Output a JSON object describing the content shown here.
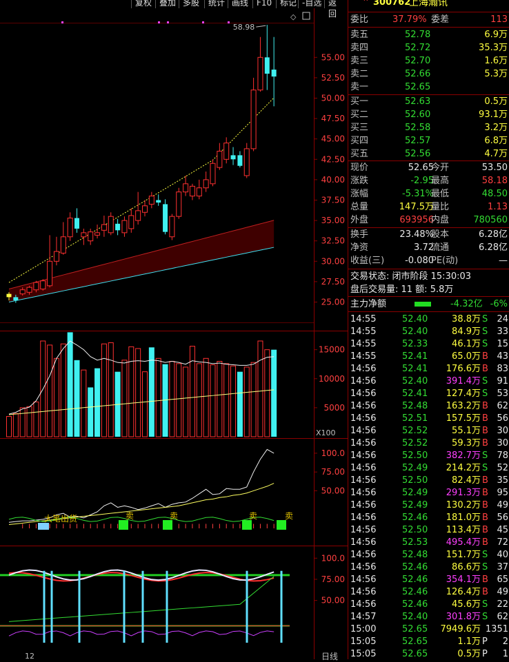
{
  "toolbar": {
    "items": [
      "复权",
      "叠加",
      "多股",
      "统计",
      "画线",
      "F10",
      "标记",
      "-自选",
      "返回"
    ]
  },
  "stock": {
    "code": "300762",
    "name": "上海瀚讯",
    "badge": "R"
  },
  "chart_data": [
    {
      "type": "candlestick",
      "title": "",
      "y_ticks": [
        55.0,
        52.5,
        50.0,
        47.5,
        45.0,
        42.5,
        40.0,
        37.5,
        35.0,
        32.5,
        30.0,
        27.5,
        25.0
      ],
      "ylim": [
        22.0,
        59.5
      ],
      "high_annotation": "58.98",
      "candles": [
        {
          "o": 25.6,
          "h": 26.2,
          "l": 25.2,
          "c": 26.0
        },
        {
          "o": 25.6,
          "h": 25.9,
          "l": 24.9,
          "c": 25.2
        },
        {
          "o": 26.0,
          "h": 26.8,
          "l": 25.8,
          "c": 26.5
        },
        {
          "o": 26.2,
          "h": 27.0,
          "l": 25.9,
          "c": 26.8
        },
        {
          "o": 26.5,
          "h": 27.6,
          "l": 26.2,
          "c": 27.4
        },
        {
          "o": 26.6,
          "h": 27.8,
          "l": 26.4,
          "c": 27.6
        },
        {
          "o": 27.0,
          "h": 33.2,
          "l": 26.8,
          "c": 30.0
        },
        {
          "o": 30.0,
          "h": 33.0,
          "l": 29.5,
          "c": 31.2
        },
        {
          "o": 31.0,
          "h": 34.8,
          "l": 30.8,
          "c": 33.0
        },
        {
          "o": 33.0,
          "h": 36.0,
          "l": 32.5,
          "c": 35.3
        },
        {
          "o": 35.3,
          "h": 36.5,
          "l": 33.5,
          "c": 34.0
        },
        {
          "o": 33.0,
          "h": 34.0,
          "l": 32.0,
          "c": 33.5
        },
        {
          "o": 32.5,
          "h": 34.0,
          "l": 32.0,
          "c": 33.6
        },
        {
          "o": 33.2,
          "h": 34.5,
          "l": 32.8,
          "c": 33.5
        },
        {
          "o": 33.8,
          "h": 35.6,
          "l": 33.0,
          "c": 34.5
        },
        {
          "o": 33.5,
          "h": 36.0,
          "l": 33.2,
          "c": 35.5
        },
        {
          "o": 34.6,
          "h": 35.2,
          "l": 33.2,
          "c": 33.8
        },
        {
          "o": 33.5,
          "h": 35.5,
          "l": 33.0,
          "c": 35.0
        },
        {
          "o": 34.0,
          "h": 36.5,
          "l": 33.5,
          "c": 35.6
        },
        {
          "o": 35.0,
          "h": 38.5,
          "l": 34.5,
          "c": 36.2
        },
        {
          "o": 36.0,
          "h": 37.5,
          "l": 35.5,
          "c": 36.8
        },
        {
          "o": 37.0,
          "h": 38.5,
          "l": 36.5,
          "c": 38.0
        },
        {
          "o": 37.5,
          "h": 38.2,
          "l": 36.8,
          "c": 37.2
        },
        {
          "o": 37.0,
          "h": 37.6,
          "l": 33.3,
          "c": 33.6
        },
        {
          "o": 33.0,
          "h": 35.8,
          "l": 32.6,
          "c": 35.5
        },
        {
          "o": 35.5,
          "h": 39.0,
          "l": 35.2,
          "c": 38.5
        },
        {
          "o": 38.5,
          "h": 40.5,
          "l": 38.0,
          "c": 39.5
        },
        {
          "o": 38.0,
          "h": 39.5,
          "l": 37.5,
          "c": 39.2
        },
        {
          "o": 38.0,
          "h": 40.0,
          "l": 37.6,
          "c": 39.0
        },
        {
          "o": 39.0,
          "h": 41.0,
          "l": 38.5,
          "c": 40.0
        },
        {
          "o": 39.5,
          "h": 42.5,
          "l": 39.2,
          "c": 42.0
        },
        {
          "o": 41.5,
          "h": 44.5,
          "l": 41.2,
          "c": 43.5
        },
        {
          "o": 42.5,
          "h": 45.2,
          "l": 42.0,
          "c": 44.5
        },
        {
          "o": 43.0,
          "h": 44.0,
          "l": 41.8,
          "c": 42.5
        },
        {
          "o": 43.0,
          "h": 43.5,
          "l": 41.5,
          "c": 41.7
        },
        {
          "o": 40.5,
          "h": 44.5,
          "l": 40.2,
          "c": 43.8
        },
        {
          "o": 43.8,
          "h": 52.5,
          "l": 43.5,
          "c": 51.0
        },
        {
          "o": 51.0,
          "h": 57.5,
          "l": 50.8,
          "c": 55.0
        },
        {
          "o": 55.0,
          "h": 58.98,
          "l": 51.0,
          "c": 53.0
        },
        {
          "o": 53.5,
          "h": 57.5,
          "l": 49.0,
          "c": 52.65
        }
      ]
    },
    {
      "type": "bar",
      "title": "",
      "y_ticks": [
        15000,
        10000,
        5000
      ],
      "ylim": [
        0,
        16500
      ],
      "unit_label": "X100",
      "values": [
        3500,
        4000,
        5000,
        5200,
        6000,
        16500,
        15800,
        13500,
        16000,
        18000,
        13200,
        11500,
        8500,
        11800,
        16000,
        16200,
        11200,
        13200,
        15500,
        15200,
        11200,
        15400,
        13500,
        12500,
        13000,
        12600,
        12000,
        15600,
        12600,
        13500,
        12400,
        13000,
        12600,
        12200,
        11200,
        12000,
        12800,
        16500,
        15000,
        15000
      ],
      "down_flags": [
        0,
        0,
        0,
        0,
        0,
        0,
        0,
        0,
        0,
        1,
        1,
        0,
        1,
        1,
        0,
        0,
        1,
        0,
        0,
        0,
        0,
        1,
        0,
        1,
        0,
        0,
        0,
        0,
        0,
        0,
        0,
        0,
        0,
        0,
        1,
        0,
        0,
        0,
        0,
        1
      ]
    },
    {
      "type": "line",
      "title": "",
      "y_ticks": [
        100.0,
        75.0,
        50.0
      ],
      "ylim": [
        0,
        110
      ],
      "annotations": [
        "大笔出货",
        "卖",
        "卖",
        "卖",
        "卖"
      ]
    },
    {
      "type": "line",
      "title": "",
      "y_ticks": [
        100.0,
        75.0,
        50.0
      ],
      "ylim": [
        0,
        110
      ]
    }
  ],
  "date_tick": "12",
  "corner_label": "日线",
  "quote": {
    "weibi": {
      "label": "委比",
      "value": "37.79%",
      "label2": "委差",
      "value2": "113"
    },
    "asks": [
      {
        "label": "卖五",
        "price": "52.78",
        "vol": "6.9万"
      },
      {
        "label": "卖四",
        "price": "52.72",
        "vol": "35.3万"
      },
      {
        "label": "卖三",
        "price": "52.70",
        "vol": "1.6万"
      },
      {
        "label": "卖二",
        "price": "52.66",
        "vol": "5.3万"
      },
      {
        "label": "卖一",
        "price": "52.65",
        "vol": ""
      }
    ],
    "bids": [
      {
        "label": "买一",
        "price": "52.63",
        "vol": "0.5万"
      },
      {
        "label": "买二",
        "price": "52.60",
        "vol": "93.1万"
      },
      {
        "label": "买三",
        "price": "52.58",
        "vol": "3.2万"
      },
      {
        "label": "买四",
        "price": "52.57",
        "vol": "6.8万"
      },
      {
        "label": "买五",
        "price": "52.56",
        "vol": "4.7万"
      }
    ],
    "stats": [
      {
        "l1": "现价",
        "v1": "52.65",
        "l2": "今开",
        "v2": "53.50"
      },
      {
        "l1": "涨跌",
        "v1": "-2.95",
        "l2": "最高",
        "v2": "58.18"
      },
      {
        "l1": "涨幅",
        "v1": "-5.31%",
        "l2": "最低",
        "v2": "48.50"
      },
      {
        "l1": "总量",
        "v1": "147.5万",
        "l2": "量比",
        "v2": "1.13"
      },
      {
        "l1": "外盘",
        "v1": "693956",
        "l2": "内盘",
        "v2": "780560"
      }
    ],
    "info": [
      {
        "l1": "换手",
        "v1": "23.48%",
        "l2": "股本",
        "v2": "6.28亿"
      },
      {
        "l1": "净资",
        "v1": "3.72",
        "l2": "流通",
        "v2": "6.28亿"
      },
      {
        "l1": "收益(三)",
        "v1": "-0.080",
        "l2": "PE(动)",
        "v2": "—"
      }
    ],
    "status": "交易状态: 闭市阶段 15:30:03",
    "after_hours": "盘后交易量: 11  额: 5.8万",
    "net": {
      "label": "主力净额",
      "value": "-4.32亿",
      "pct": "-6%"
    }
  },
  "ticks": [
    {
      "t": "14:55",
      "p": "52.40",
      "a": "38.8万",
      "s": "S",
      "n": "24"
    },
    {
      "t": "14:55",
      "p": "52.40",
      "a": "84.9万",
      "s": "S",
      "n": "33"
    },
    {
      "t": "14:55",
      "p": "52.33",
      "a": "46.1万",
      "s": "S",
      "n": "15"
    },
    {
      "t": "14:55",
      "p": "52.41",
      "a": "65.0万",
      "s": "B",
      "n": "43"
    },
    {
      "t": "14:56",
      "p": "52.41",
      "a": "176.6万",
      "s": "B",
      "n": "83"
    },
    {
      "t": "14:56",
      "p": "52.40",
      "a": "391.4万",
      "s": "S",
      "n": "91"
    },
    {
      "t": "14:56",
      "p": "52.41",
      "a": "127.4万",
      "s": "S",
      "n": "53"
    },
    {
      "t": "14:56",
      "p": "52.48",
      "a": "163.2万",
      "s": "B",
      "n": "62"
    },
    {
      "t": "14:56",
      "p": "52.51",
      "a": "157.5万",
      "s": "B",
      "n": "56"
    },
    {
      "t": "14:56",
      "p": "52.52",
      "a": "55.1万",
      "s": "B",
      "n": "30"
    },
    {
      "t": "14:56",
      "p": "52.52",
      "a": "59.3万",
      "s": "B",
      "n": "30"
    },
    {
      "t": "14:56",
      "p": "52.50",
      "a": "382.7万",
      "s": "S",
      "n": "78"
    },
    {
      "t": "14:56",
      "p": "52.49",
      "a": "214.2万",
      "s": "S",
      "n": "52"
    },
    {
      "t": "14:56",
      "p": "52.50",
      "a": "82.4万",
      "s": "B",
      "n": "35"
    },
    {
      "t": "14:56",
      "p": "52.49",
      "a": "291.3万",
      "s": "B",
      "n": "95"
    },
    {
      "t": "14:56",
      "p": "52.49",
      "a": "130.2万",
      "s": "B",
      "n": "49"
    },
    {
      "t": "14:56",
      "p": "52.46",
      "a": "181.0万",
      "s": "B",
      "n": "56"
    },
    {
      "t": "14:56",
      "p": "52.50",
      "a": "113.4万",
      "s": "B",
      "n": "45"
    },
    {
      "t": "14:56",
      "p": "52.53",
      "a": "495.4万",
      "s": "B",
      "n": "72"
    },
    {
      "t": "14:56",
      "p": "52.48",
      "a": "151.7万",
      "s": "S",
      "n": "40"
    },
    {
      "t": "14:56",
      "p": "52.46",
      "a": "86.6万",
      "s": "S",
      "n": "37"
    },
    {
      "t": "14:56",
      "p": "52.46",
      "a": "354.1万",
      "s": "B",
      "n": "65"
    },
    {
      "t": "14:56",
      "p": "52.46",
      "a": "126.4万",
      "s": "B",
      "n": "49"
    },
    {
      "t": "14:56",
      "p": "52.46",
      "a": "45.6万",
      "s": "S",
      "n": "22"
    },
    {
      "t": "14:57",
      "p": "52.40",
      "a": "301.8万",
      "s": "S",
      "n": "62"
    },
    {
      "t": "15:00",
      "p": "52.65",
      "a": "7949.6万",
      "s": "",
      "n": "1351"
    },
    {
      "t": "15:05",
      "p": "52.65",
      "a": "1.1万",
      "s": "P",
      "n": "2"
    },
    {
      "t": "15:05",
      "p": "52.65",
      "a": "0.5万",
      "s": "P",
      "n": "1"
    }
  ],
  "colors": {
    "up": "#ff3030",
    "down": "#40f0f0",
    "bg": "#000000",
    "grid": "#8b0000",
    "green": "#33dd33",
    "magenta": "#ff40ff",
    "yellow": "#ffff40"
  }
}
